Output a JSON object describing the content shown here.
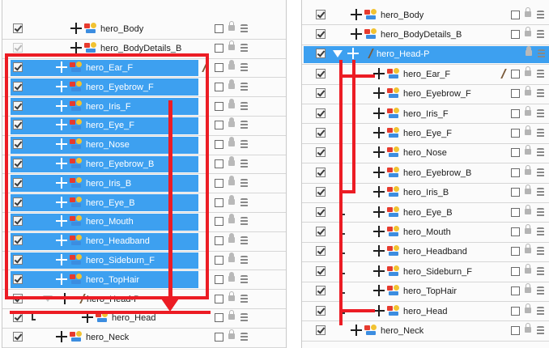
{
  "accent_color": "#3da0f0",
  "annotation_color": "#ec1c24",
  "left_panel": {
    "rows": [
      {
        "name": "hero_Body",
        "selected": false
      },
      {
        "name": "hero_BodyDetails_B",
        "selected": false
      },
      {
        "name": "hero_Ear_F",
        "selected": true
      },
      {
        "name": "hero_Eyebrow_F",
        "selected": true
      },
      {
        "name": "hero_Iris_F",
        "selected": true
      },
      {
        "name": "hero_Eye_F",
        "selected": true
      },
      {
        "name": "hero_Nose",
        "selected": true
      },
      {
        "name": "hero_Eyebrow_B",
        "selected": true
      },
      {
        "name": "hero_Iris_B",
        "selected": true
      },
      {
        "name": "hero_Eye_B",
        "selected": true
      },
      {
        "name": "hero_Mouth",
        "selected": true
      },
      {
        "name": "hero_Headband",
        "selected": true
      },
      {
        "name": "hero_Sideburn_F",
        "selected": true
      },
      {
        "name": "hero_TopHair",
        "selected": true
      },
      {
        "name": "hero_Head-P",
        "selected": false
      },
      {
        "name": "hero_Head",
        "selected": false
      },
      {
        "name": "hero_Neck",
        "selected": false
      }
    ]
  },
  "right_panel": {
    "rows": [
      {
        "name": "hero_Body",
        "selected": false
      },
      {
        "name": "hero_BodyDetails_B",
        "selected": false
      },
      {
        "name": "hero_Head-P",
        "selected": true
      },
      {
        "name": "hero_Ear_F",
        "selected": false
      },
      {
        "name": "hero_Eyebrow_F",
        "selected": false
      },
      {
        "name": "hero_Iris_F",
        "selected": false
      },
      {
        "name": "hero_Eye_F",
        "selected": false
      },
      {
        "name": "hero_Nose",
        "selected": false
      },
      {
        "name": "hero_Eyebrow_B",
        "selected": false
      },
      {
        "name": "hero_Iris_B",
        "selected": false
      },
      {
        "name": "hero_Eye_B",
        "selected": false
      },
      {
        "name": "hero_Mouth",
        "selected": false
      },
      {
        "name": "hero_Headband",
        "selected": false
      },
      {
        "name": "hero_Sideburn_F",
        "selected": false
      },
      {
        "name": "hero_TopHair",
        "selected": false
      },
      {
        "name": "hero_Head",
        "selected": false
      },
      {
        "name": "hero_Neck",
        "selected": false
      }
    ]
  }
}
